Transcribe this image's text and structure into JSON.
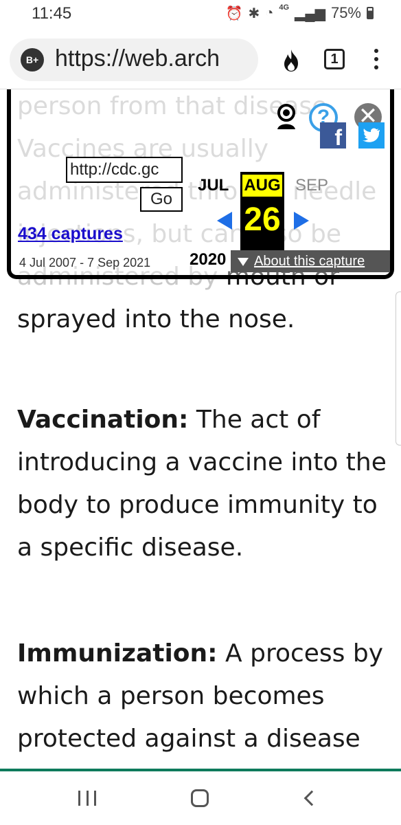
{
  "status_bar": {
    "time": "11:45",
    "network": "4G",
    "battery": "75%"
  },
  "browser": {
    "site_badge": "B+",
    "url": "https://web.arch",
    "tab_count": "1"
  },
  "wayback": {
    "url_input": "http://cdc.gc",
    "go_label": "Go",
    "captures": "434 captures",
    "range": "4 Jul 2007 - 7 Sep 2021",
    "prev_month": "JUL",
    "current_month": "AUG",
    "next_month": "SEP",
    "day": "26",
    "year": "2020",
    "about": "About this capture",
    "help_symbol": "?",
    "close_symbol": "✕",
    "facebook_letter": "f"
  },
  "article": {
    "intro_faded": "person from that disease. Vaccines are usually administered through needle injections, but can also be administered by",
    "intro_visible": "mouth or sprayed into the nose.",
    "vaccination_term": "Vaccination:",
    "vaccination_def": "The act of introducing a vaccine into the body to produce immunity to a specific disease.",
    "immunization_term": "Immunization:",
    "immunization_def": "A process by which a person becomes protected against a disease"
  },
  "colors": {
    "wayback_yellow": "#ffff00",
    "wayback_arrow_blue": "#1e6ee6",
    "capture_link": "#1a0dcc",
    "nav_accent": "#0e7a5c"
  }
}
